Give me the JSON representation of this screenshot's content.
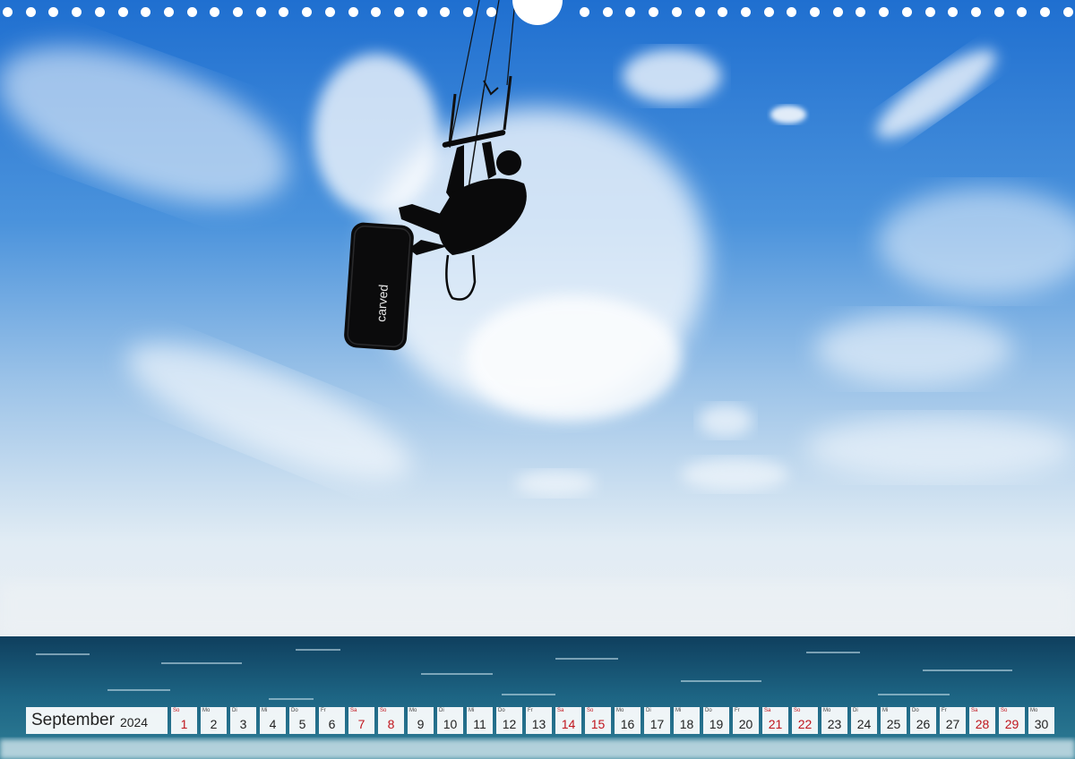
{
  "calendar": {
    "month": "September",
    "year": "2024",
    "days": [
      {
        "dow": "So",
        "num": "1",
        "weekend": "sun"
      },
      {
        "dow": "Mo",
        "num": "2",
        "weekend": ""
      },
      {
        "dow": "Di",
        "num": "3",
        "weekend": ""
      },
      {
        "dow": "Mi",
        "num": "4",
        "weekend": ""
      },
      {
        "dow": "Do",
        "num": "5",
        "weekend": ""
      },
      {
        "dow": "Fr",
        "num": "6",
        "weekend": ""
      },
      {
        "dow": "Sa",
        "num": "7",
        "weekend": "sat"
      },
      {
        "dow": "So",
        "num": "8",
        "weekend": "sun"
      },
      {
        "dow": "Mo",
        "num": "9",
        "weekend": ""
      },
      {
        "dow": "Di",
        "num": "10",
        "weekend": ""
      },
      {
        "dow": "Mi",
        "num": "11",
        "weekend": ""
      },
      {
        "dow": "Do",
        "num": "12",
        "weekend": ""
      },
      {
        "dow": "Fr",
        "num": "13",
        "weekend": ""
      },
      {
        "dow": "Sa",
        "num": "14",
        "weekend": "sat"
      },
      {
        "dow": "So",
        "num": "15",
        "weekend": "sun"
      },
      {
        "dow": "Mo",
        "num": "16",
        "weekend": ""
      },
      {
        "dow": "Di",
        "num": "17",
        "weekend": ""
      },
      {
        "dow": "Mi",
        "num": "18",
        "weekend": ""
      },
      {
        "dow": "Do",
        "num": "19",
        "weekend": ""
      },
      {
        "dow": "Fr",
        "num": "20",
        "weekend": ""
      },
      {
        "dow": "Sa",
        "num": "21",
        "weekend": "sat"
      },
      {
        "dow": "So",
        "num": "22",
        "weekend": "sun"
      },
      {
        "dow": "Mo",
        "num": "23",
        "weekend": ""
      },
      {
        "dow": "Di",
        "num": "24",
        "weekend": ""
      },
      {
        "dow": "Mi",
        "num": "25",
        "weekend": ""
      },
      {
        "dow": "Do",
        "num": "26",
        "weekend": ""
      },
      {
        "dow": "Fr",
        "num": "27",
        "weekend": ""
      },
      {
        "dow": "Sa",
        "num": "28",
        "weekend": "sat"
      },
      {
        "dow": "So",
        "num": "29",
        "weekend": "sun"
      },
      {
        "dow": "Mo",
        "num": "30",
        "weekend": ""
      }
    ]
  },
  "board": {
    "brand_text": "carved"
  },
  "colors": {
    "weekend_red": "#c0141c",
    "sky_top": "#1f6fd0",
    "sea": "#14506e"
  }
}
